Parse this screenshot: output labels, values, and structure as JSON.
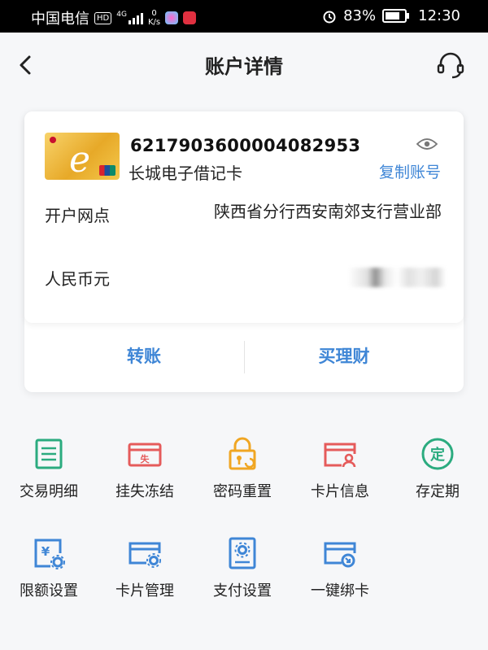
{
  "status_bar": {
    "carrier": "中国电信",
    "hd": "HD",
    "net": "4G",
    "speed_value": "0",
    "speed_unit": "K/s",
    "battery": "83%",
    "time": "12:30"
  },
  "header": {
    "title": "账户详情"
  },
  "account": {
    "number": "6217903600004082953",
    "card_type": "长城电子借记卡",
    "copy_label": "复制账号",
    "branch_label": "开户网点",
    "branch_value": "陕西省分行西安南郊支行营业部",
    "currency_label": "人民币元"
  },
  "actions": {
    "transfer": "转账",
    "buy_wealth": "买理财"
  },
  "functions": [
    {
      "label": "交易明细",
      "icon": "transaction-list-icon",
      "color": "#2bab7f"
    },
    {
      "label": "挂失冻结",
      "icon": "report-loss-icon",
      "color": "#e55b5b"
    },
    {
      "label": "密码重置",
      "icon": "password-lock-icon",
      "color": "#f0a623"
    },
    {
      "label": "卡片信息",
      "icon": "card-info-icon",
      "color": "#e55b5b"
    },
    {
      "label": "存定期",
      "icon": "fixed-deposit-icon",
      "color": "#2bab7f"
    },
    {
      "label": "限额设置",
      "icon": "limit-setting-icon",
      "color": "#3f86d6"
    },
    {
      "label": "卡片管理",
      "icon": "card-manage-icon",
      "color": "#3f86d6"
    },
    {
      "label": "支付设置",
      "icon": "payment-setting-icon",
      "color": "#3f86d6"
    },
    {
      "label": "一键绑卡",
      "icon": "bind-card-icon",
      "color": "#3f86d6"
    }
  ],
  "colors": {
    "accent_blue": "#3f86d6",
    "green": "#2bab7f",
    "red": "#e55b5b",
    "orange": "#f0a623"
  }
}
